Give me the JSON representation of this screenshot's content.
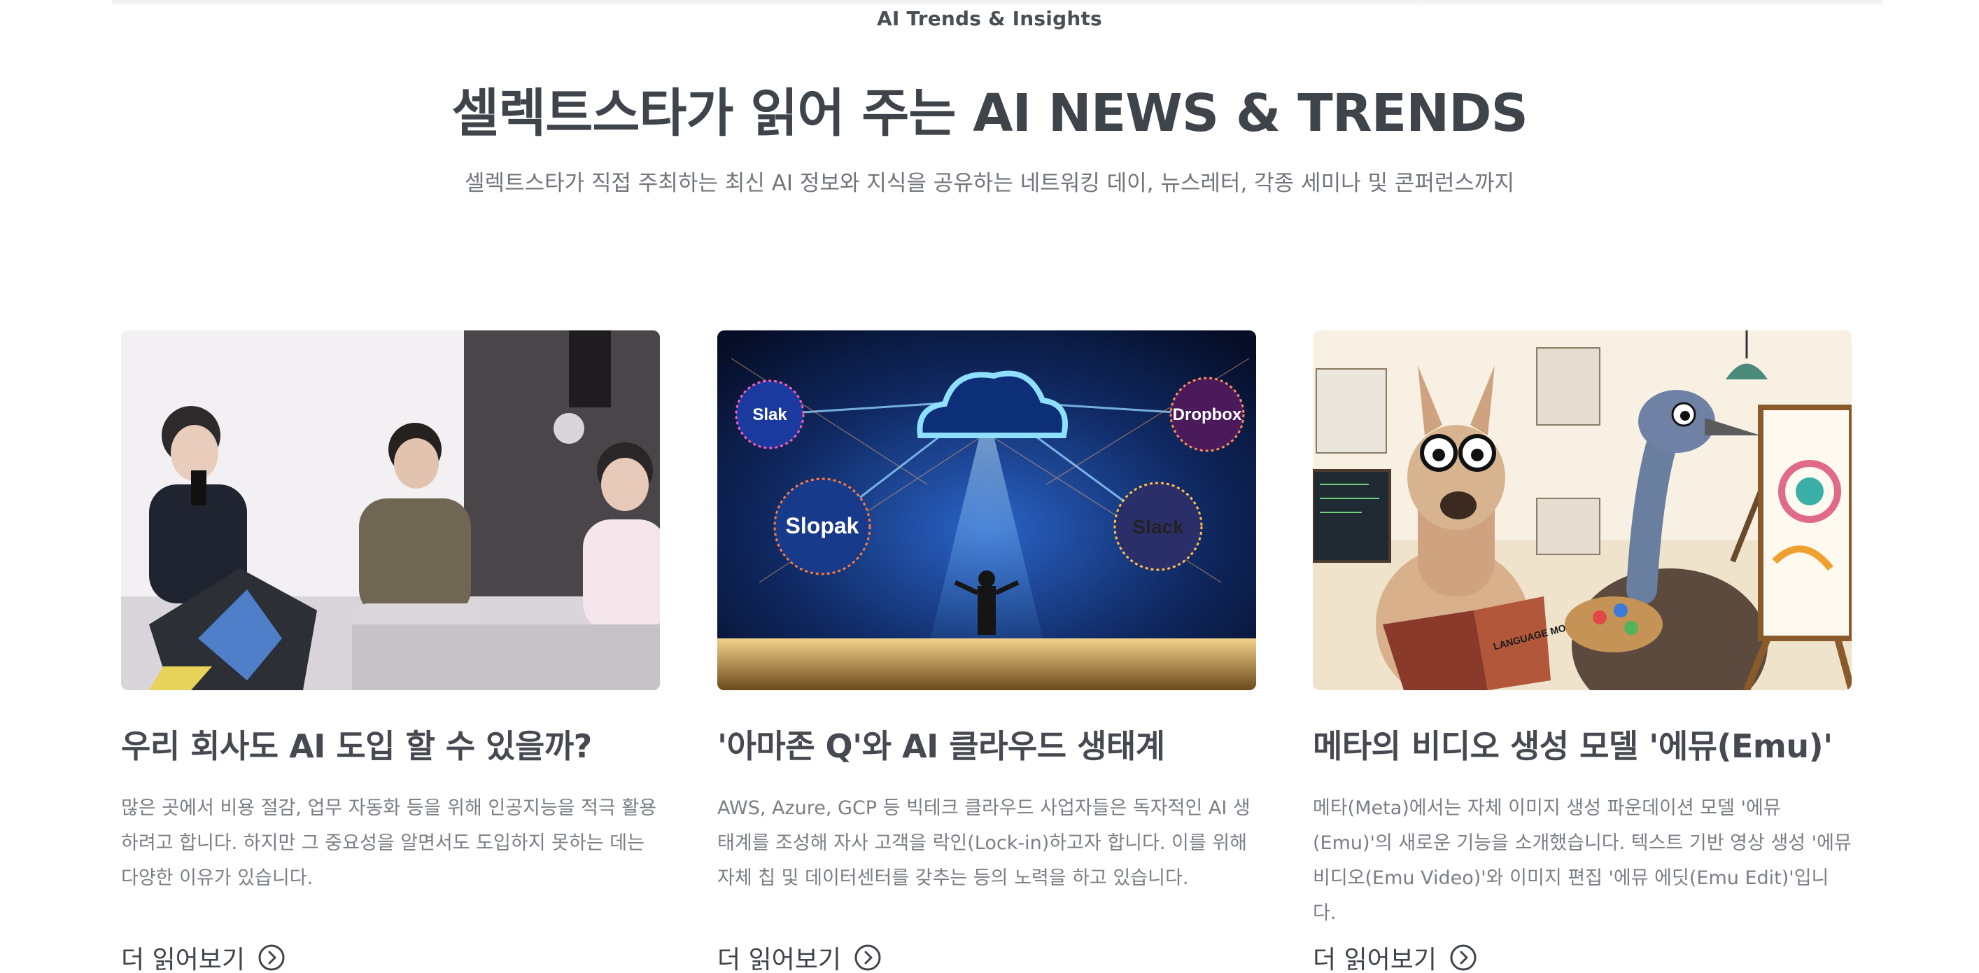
{
  "section": {
    "eyebrow": "AI Trends & Insights",
    "title": "셀렉트스타가 읽어 주는 AI NEWS & TRENDS",
    "subtitle": "셀렉트스타가 직접 주최하는 최신 AI 정보와 지식을 공유하는 네트워킹 데이, 뉴스레터, 각종 세미나 및 콘퍼런스까지"
  },
  "cards": [
    {
      "title": "우리 회사도 AI 도입 할 수 있을까?",
      "description": "많은 곳에서 비용 절감, 업무 자동화 등을 위해 인공지능을 적극 활용하려고 합니다. 하지만 그 중요성을 알면서도 도입하지 못하는 데는 다양한 이유가 있습니다.",
      "read_more": "더 읽어보기",
      "image": "seminar-panel-photo"
    },
    {
      "title": "'아마존 Q'와 AI 클라우드 생태계",
      "description": "AWS, Azure, GCP 등 빅테크 클라우드 사업자들은 독자적인 AI 생태계를 조성해 자사 고객을 락인(Lock-in)하고자 합니다. 이를 위해 자체 칩 및 데이터센터를 갖추는 등의 노력을 하고 있습니다.",
      "read_more": "더 읽어보기",
      "image": "ai-cloud-ecosystem-illustration",
      "image_labels": [
        "Slak",
        "Dropbox",
        "Slopak",
        "Slack"
      ]
    },
    {
      "title": "메타의 비디오 생성 모델 '에뮤(Emu)'",
      "description": "메타(Meta)에서는 자체 이미지 생성 파운데이션 모델 '에뮤(Emu)'의 새로운 기능을 소개했습니다. 텍스트 기반 영상 생성 '에뮤 비디오(Emu Video)'와 이미지 편집 '에뮤 에딧(Emu Edit)'입니다.",
      "read_more": "더 읽어보기",
      "image": "llama-and-emu-painting-illustration",
      "image_labels": [
        "LANGUAGE MODELS"
      ]
    }
  ],
  "icons": {
    "read_more": "chevron-right-circle-icon"
  }
}
